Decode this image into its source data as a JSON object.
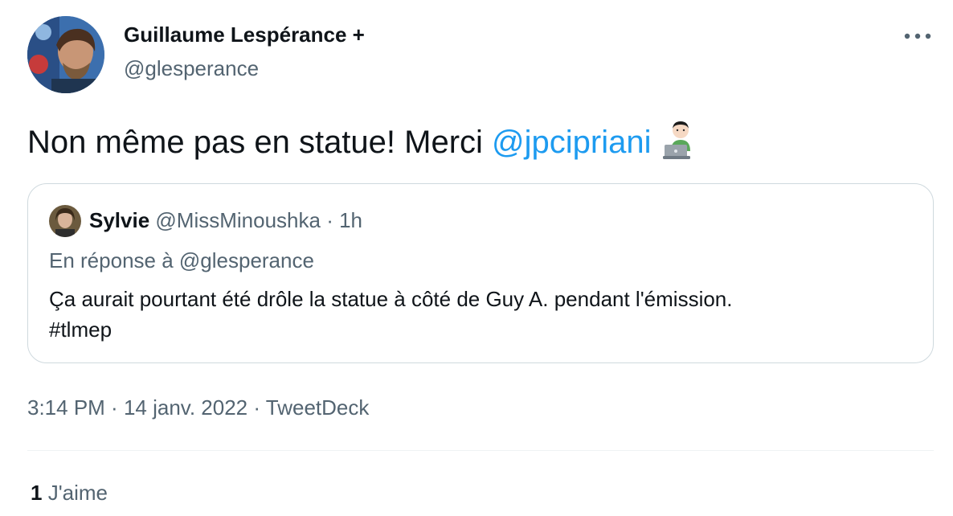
{
  "author": {
    "display_name": "Guillaume Lespérance +",
    "handle": "@glesperance"
  },
  "tweet": {
    "text_before": "Non même pas en statue! Merci ",
    "mention": "@jpcipriani",
    "emoji": "man-technologist-emoji"
  },
  "quoted_tweet": {
    "name": "Sylvie",
    "handle": "@MissMinoushka",
    "separator": " · ",
    "time": "1h",
    "reply_prefix": "En réponse à ",
    "reply_to": "@glesperance",
    "body_line1": "Ça aurait pourtant été drôle la statue à côté de Guy A. pendant l'émission.",
    "body_line2": "#tlmep"
  },
  "meta": {
    "time": "3:14 PM",
    "separator": " · ",
    "date": "14 janv. 2022",
    "source": "TweetDeck"
  },
  "likes": {
    "count": "1",
    "label": "J'aime"
  },
  "icons": {
    "more": "more-icon",
    "emoji": "technologist-icon"
  },
  "colors": {
    "text": "#0f1419",
    "secondary": "#536471",
    "link": "#1d9bf0",
    "border": "#cfd9de"
  }
}
